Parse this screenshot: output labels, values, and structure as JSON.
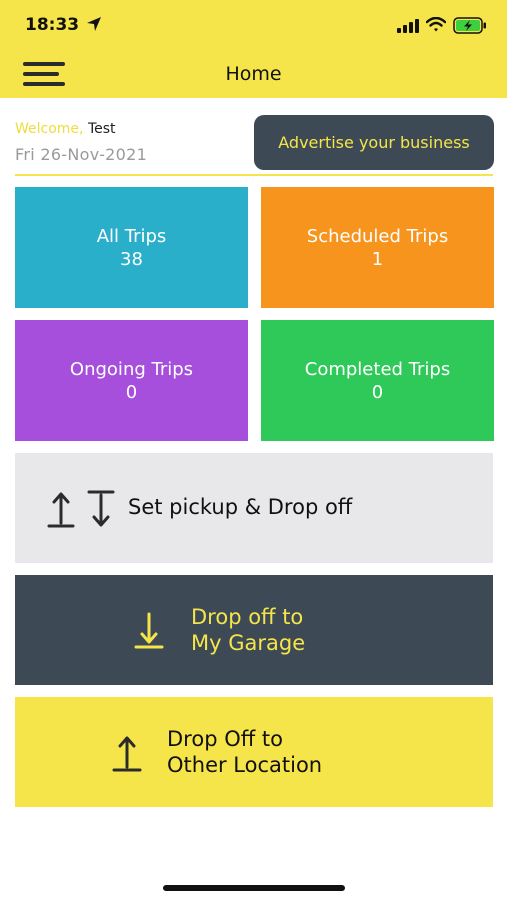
{
  "status_bar": {
    "time": "18:33"
  },
  "header": {
    "title": "Home"
  },
  "welcome": {
    "label": "Welcome,",
    "name": "Test",
    "date": "Fri 26-Nov-2021"
  },
  "advertise": {
    "label": "Advertise your business"
  },
  "tiles": [
    {
      "label": "All Trips",
      "count": "38",
      "color": "#2aafca"
    },
    {
      "label": "Scheduled Trips",
      "count": "1",
      "color": "#f7941d"
    },
    {
      "label": "Ongoing Trips",
      "count": "0",
      "color": "#a64fdc"
    },
    {
      "label": "Completed Trips",
      "count": "0",
      "color": "#2fc95a"
    }
  ],
  "actions": {
    "pickup": {
      "label": "Set pickup & Drop off"
    },
    "garage": {
      "line1": "Drop off to",
      "line2": "My Garage"
    },
    "other": {
      "line1": "Drop Off to",
      "line2": "Other Location"
    }
  },
  "colors": {
    "brand_yellow": "#f5e54a",
    "dark_slate": "#3d4a55",
    "light_gray": "#e8e8ea"
  },
  "icons": [
    "location-arrow-icon",
    "signal-icon",
    "wifi-icon",
    "battery-charging-icon",
    "menu-icon",
    "upload-icon",
    "download-icon"
  ]
}
